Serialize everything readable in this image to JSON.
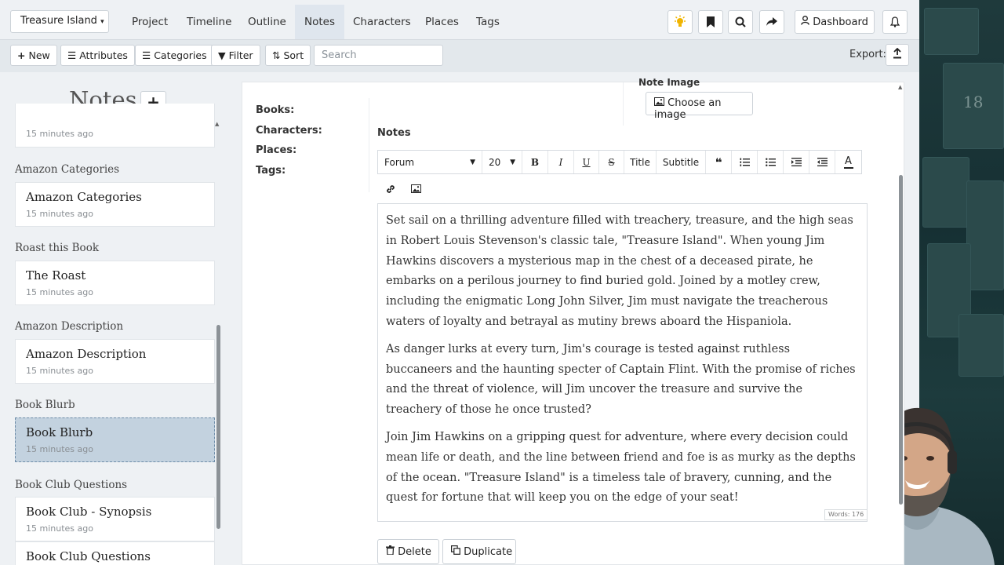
{
  "topnav": {
    "project_selector": "Treasure Island",
    "links": [
      {
        "label": "Project"
      },
      {
        "label": "Timeline"
      },
      {
        "label": "Outline"
      },
      {
        "label": "Notes"
      },
      {
        "label": "Characters"
      },
      {
        "label": "Places"
      },
      {
        "label": "Tags"
      }
    ],
    "active_link": "Notes",
    "dashboard_label": "Dashboard",
    "accent_color": "#f0b400"
  },
  "toolbar": {
    "new_label": "New",
    "attributes_label": "Attributes",
    "categories_label": "Categories",
    "filter_label": "Filter",
    "sort_label": "Sort",
    "search_placeholder": "Search",
    "export_label": "Export:"
  },
  "sidebar": {
    "title": "Notes",
    "first_card_time": "15 minutes ago",
    "groups": [
      {
        "label": "Amazon Categories",
        "card_title": "Amazon Categories",
        "card_time": "15 minutes ago"
      },
      {
        "label": "Roast this Book",
        "card_title": "The Roast",
        "card_time": "15 minutes ago"
      },
      {
        "label": "Amazon Description",
        "card_title": "Amazon Description",
        "card_time": "15 minutes ago"
      },
      {
        "label": "Book Blurb",
        "card_title": "Book Blurb",
        "card_time": "15 minutes ago"
      },
      {
        "label": "Book Club Questions",
        "card_title": "Book Club - Synopsis",
        "card_time": "15 minutes ago"
      }
    ],
    "last_card_title": "Book Club Questions",
    "selected_color": "#c3d2df"
  },
  "note": {
    "meta": {
      "books": "Books:",
      "characters": "Characters:",
      "places": "Places:",
      "tags": "Tags:"
    },
    "note_image_label": "Note Image",
    "choose_image_label": "Choose an image",
    "notes_label": "Notes",
    "editor_toolbar": {
      "font": "Forum",
      "size": "20",
      "title_btn": "Title",
      "subtitle_btn": "Subtitle"
    },
    "paragraphs": [
      "Set sail on a thrilling adventure filled with treachery, treasure, and the high seas in Robert Louis Stevenson's classic tale, \"Treasure Island\". When young Jim Hawkins discovers a mysterious map in the chest of a deceased pirate, he embarks on a perilous journey to find buried gold. Joined by a motley crew, including the enigmatic Long John Silver, Jim must navigate the treacherous waters of loyalty and betrayal as mutiny brews aboard the Hispaniola.",
      "As danger lurks at every turn, Jim's courage is tested against ruthless buccaneers and the haunting specter of Captain Flint. With the promise of riches and the threat of violence, will Jim uncover the treasure and survive the treachery of those he once trusted?",
      "Join Jim Hawkins on a gripping quest for adventure, where every decision could mean life or death, and the line between friend and foe is as murky as the depths of the ocean. \"Treasure Island\" is a timeless tale of bravery, cunning, and the quest for fortune that will keep you on the edge of your seat!"
    ],
    "word_count": "Words: 176",
    "delete_label": "Delete",
    "duplicate_label": "Duplicate"
  }
}
